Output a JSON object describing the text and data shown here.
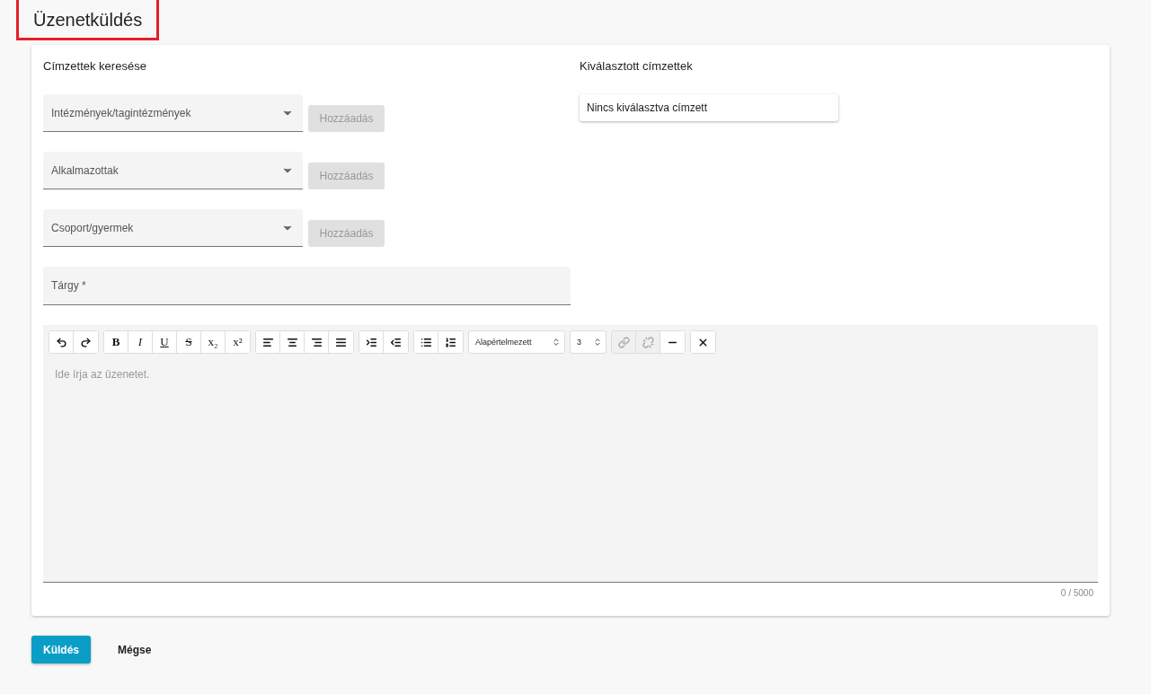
{
  "page_title": "Üzenetküldés",
  "search": {
    "title": "Címzettek keresése",
    "selects": [
      {
        "label": "Intézmények/tagintézmények",
        "button": "Hozzáadás",
        "disabled": true
      },
      {
        "label": "Alkalmazottak",
        "button": "Hozzáadás",
        "disabled": true
      },
      {
        "label": "Csoport/gyermek",
        "button": "Hozzáadás",
        "disabled": true
      }
    ],
    "subject": {
      "label": "Tárgy *"
    }
  },
  "selected": {
    "title": "Kiválasztott címzettek",
    "empty": "Nincs kiválasztva címzett"
  },
  "editor": {
    "toolbar": [
      {
        "items": [
          {
            "kind": "icon"
          },
          {
            "kind": "icon"
          }
        ]
      },
      {
        "items": [
          {
            "kind": "text",
            "label": "B"
          },
          {
            "kind": "text",
            "label": "I"
          },
          {
            "kind": "text",
            "label": "U"
          },
          {
            "kind": "text",
            "label": "S"
          },
          {
            "kind": "text",
            "label": "x₂"
          },
          {
            "kind": "text",
            "label": "x²"
          }
        ]
      },
      {
        "items": [
          {
            "kind": "icon"
          },
          {
            "kind": "icon"
          },
          {
            "kind": "icon"
          },
          {
            "kind": "icon"
          }
        ]
      },
      {
        "items": [
          {
            "kind": "icon"
          },
          {
            "kind": "icon"
          }
        ]
      },
      {
        "items": [
          {
            "kind": "icon"
          },
          {
            "kind": "icon"
          }
        ]
      },
      {
        "items": [
          {
            "kind": "select",
            "value": "Alapértelmezett"
          }
        ]
      },
      {
        "items": [
          {
            "kind": "select",
            "value": "3"
          }
        ]
      },
      {
        "items": [
          {
            "kind": "icon",
            "disabled": true
          },
          {
            "kind": "icon",
            "disabled": true
          },
          {
            "kind": "icon",
            "disabled": false
          }
        ]
      },
      {
        "items": [
          {
            "kind": "icon",
            "disabled": false
          }
        ]
      }
    ],
    "placeholder": "Ide írja az üzenetet.",
    "counter": "0 / 5000"
  },
  "actions": {
    "send": "Küldés",
    "cancel": "Mégse"
  }
}
